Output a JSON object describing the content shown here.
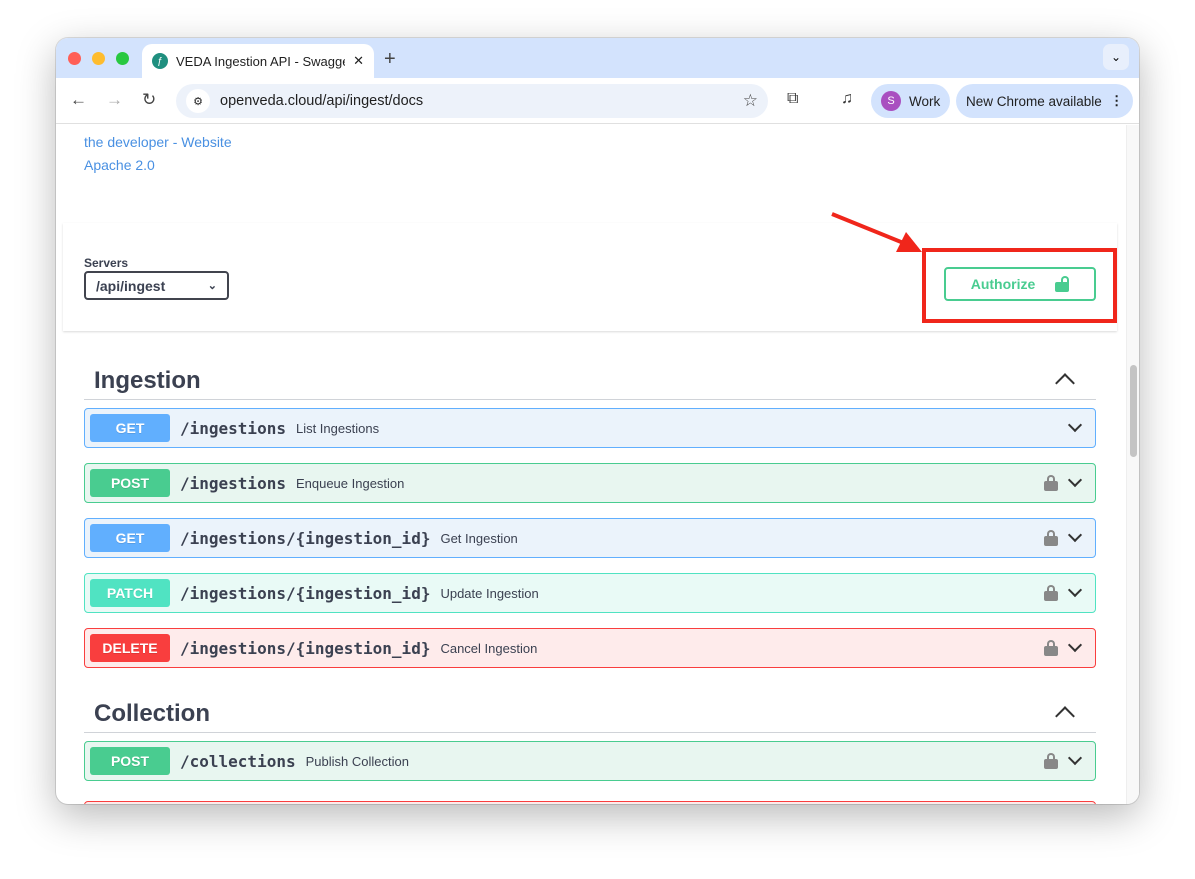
{
  "browser": {
    "tab_title": "VEDA Ingestion API - Swagger UI",
    "url": "openveda.cloud/api/ingest/docs",
    "profile_initial": "S",
    "profile_label": "Work",
    "update_label": "New Chrome available"
  },
  "info": {
    "developer_link": "the developer - Website",
    "license_link": "Apache 2.0"
  },
  "servers": {
    "label": "Servers",
    "selected": "/api/ingest"
  },
  "authorize": {
    "label": "Authorize"
  },
  "colors": {
    "get": "#61affe",
    "post": "#49cc90",
    "patch": "#50e3c2",
    "delete": "#f93e3e",
    "highlight": "#f0261b"
  },
  "sections": [
    {
      "title": "Ingestion",
      "operations": [
        {
          "method": "GET",
          "path": "/ingestions",
          "summary": "List Ingestions",
          "locked": false
        },
        {
          "method": "POST",
          "path": "/ingestions",
          "summary": "Enqueue Ingestion",
          "locked": true
        },
        {
          "method": "GET",
          "path": "/ingestions/{ingestion_id}",
          "summary": "Get Ingestion",
          "locked": true
        },
        {
          "method": "PATCH",
          "path": "/ingestions/{ingestion_id}",
          "summary": "Update Ingestion",
          "locked": true
        },
        {
          "method": "DELETE",
          "path": "/ingestions/{ingestion_id}",
          "summary": "Cancel Ingestion",
          "locked": true
        }
      ]
    },
    {
      "title": "Collection",
      "operations": [
        {
          "method": "POST",
          "path": "/collections",
          "summary": "Publish Collection",
          "locked": true
        }
      ]
    }
  ]
}
